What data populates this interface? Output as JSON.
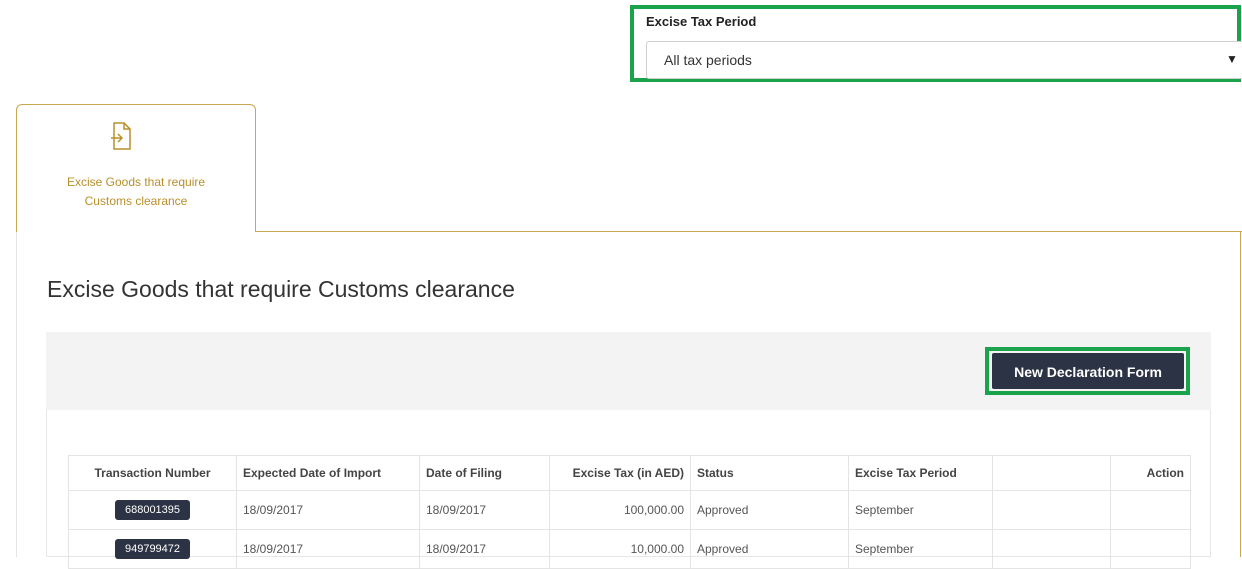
{
  "filter": {
    "label": "Excise Tax Period",
    "selected": "All tax periods",
    "caret_icon": "caret-down-icon"
  },
  "tab": {
    "icon": "document-import-icon",
    "label_line1": "Excise Goods that require",
    "label_line2": "Customs clearance"
  },
  "section": {
    "title": "Excise Goods that require Customs clearance",
    "new_button": "New Declaration Form"
  },
  "table": {
    "headers": [
      "Transaction Number",
      "Expected Date of Import",
      "Date of Filing",
      "Excise Tax (in AED)",
      "Status",
      "Excise Tax Period",
      "",
      "Action"
    ],
    "rows": [
      {
        "txn": "688001395",
        "expected": "18/09/2017",
        "filed": "18/09/2017",
        "tax": "100,000.00",
        "status": "Approved",
        "period": "September",
        "extra": "",
        "action": ""
      },
      {
        "txn": "949799472",
        "expected": "18/09/2017",
        "filed": "18/09/2017",
        "tax": "10,000.00",
        "status": "Approved",
        "period": "September",
        "extra": "",
        "action": ""
      }
    ]
  },
  "colors": {
    "accent": "#c9a64f",
    "highlight": "#1aa34a",
    "button": "#2c3344"
  }
}
